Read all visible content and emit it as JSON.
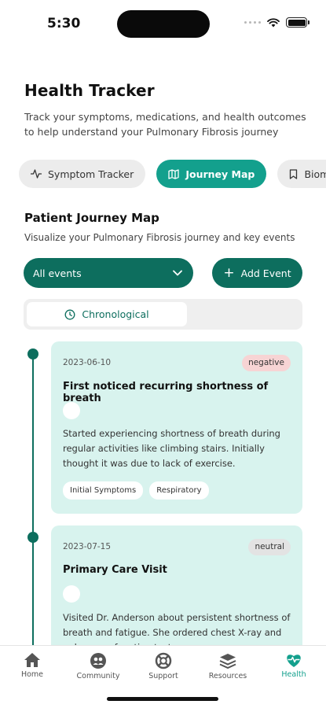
{
  "status_bar": {
    "time": "5:30"
  },
  "header": {
    "title": "Health Tracker",
    "description": "Track your symptoms, medications, and health outcomes to help understand your Pulmonary Fibrosis journey"
  },
  "tabs": [
    {
      "label": "Symptom Tracker",
      "icon": "activity-icon",
      "active": false
    },
    {
      "label": "Journey Map",
      "icon": "map-icon",
      "active": true
    },
    {
      "label": "Bioma",
      "icon": "bookmark-icon",
      "active": false
    }
  ],
  "journey": {
    "title": "Patient Journey Map",
    "description": "Visualize your Pulmonary Fibrosis journey and key events",
    "filter_value": "All events",
    "add_label": "Add Event",
    "view_label": "Chronological"
  },
  "events": [
    {
      "date": "2023-06-10",
      "sentiment": "negative",
      "title": "First noticed recurring shortness of breath",
      "description": "Started experiencing shortness of breath during regular activities like climbing stairs. Initially thought it was due to lack of exercise.",
      "tags": [
        "Initial Symptoms",
        "Respiratory"
      ]
    },
    {
      "date": "2023-07-15",
      "sentiment": "neutral",
      "title": "Primary Care Visit",
      "description": "Visited Dr. Anderson about persistent shortness of breath and fatigue. She ordered chest X-ray and pulmonary function test."
    }
  ],
  "nav": [
    {
      "label": "Home",
      "icon": "home-icon"
    },
    {
      "label": "Community",
      "icon": "community-icon"
    },
    {
      "label": "Support",
      "icon": "support-icon"
    },
    {
      "label": "Resources",
      "icon": "resources-icon"
    },
    {
      "label": "Health",
      "icon": "heart-pulse-icon",
      "active": true
    }
  ],
  "colors": {
    "accent": "#13a08d",
    "primary_dark": "#0d6e5e",
    "card_bg": "#d8f3ee"
  }
}
